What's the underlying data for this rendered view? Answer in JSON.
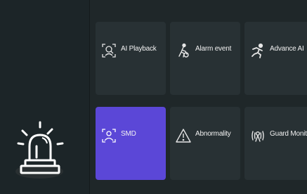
{
  "sidebar": {
    "alarm_icon": "alarm-siren-icon"
  },
  "tiles": [
    {
      "label": "AI Playback",
      "icon": "ai-playback-icon",
      "active": false
    },
    {
      "label": "Alarm event",
      "icon": "alarm-event-icon",
      "active": false
    },
    {
      "label": "Advance AI",
      "icon": "advance-ai-icon",
      "active": false
    },
    {
      "label": "SMD",
      "icon": "smd-icon",
      "active": true
    },
    {
      "label": "Abnormality",
      "icon": "abnormality-warning-icon",
      "active": false
    },
    {
      "label": "Guard Monito",
      "icon": "guard-monitor-icon",
      "active": false
    }
  ],
  "colors": {
    "background": "#1f2729",
    "tile": "#283134",
    "active_tile": "#5b47d7",
    "text": "#f1f1f1"
  }
}
